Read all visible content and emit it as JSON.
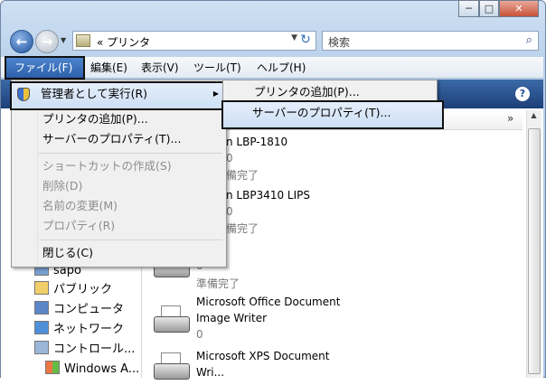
{
  "window": {
    "minimize": "─",
    "maximize": "□",
    "close": "✕"
  },
  "nav": {
    "back": "←",
    "forward": "→",
    "history": "▼",
    "address_text": "« プリンタ",
    "address_dropdown": "▼",
    "refresh": "↻",
    "search_placeholder": "検索",
    "search_icon": "⌕"
  },
  "menubar": [
    {
      "label": "ファイル(F)"
    },
    {
      "label": "編集(E)"
    },
    {
      "label": "表示(V)"
    },
    {
      "label": "ツール(T)"
    },
    {
      "label": "ヘルプ(H)"
    }
  ],
  "file_menu": {
    "runas": "管理者として実行(R)",
    "add_printer": "プリンタの追加(P)...",
    "server_props": "サーバーのプロパティ(T)...",
    "create_shortcut": "ショートカットの作成(S)",
    "delete": "削除(D)",
    "rename": "名前の変更(M)",
    "properties": "プロパティ(R)",
    "close": "閉じる(C)"
  },
  "submenu": {
    "add_printer": "プリンタの追加(P)...",
    "server_props": "サーバーのプロパティ(T)..."
  },
  "toolbar": {
    "help": "?"
  },
  "columns": {
    "more": "»"
  },
  "tree": [
    {
      "label": "sapo",
      "icon": "user-icon"
    },
    {
      "label": "パブリック",
      "icon": "folder-icon"
    },
    {
      "label": "コンピュータ",
      "icon": "computer-icon"
    },
    {
      "label": "ネットワーク",
      "icon": "network-icon"
    },
    {
      "label": "コントロール...",
      "icon": "control-panel-icon"
    },
    {
      "label": "Windows A...",
      "icon": "windows-icon"
    }
  ],
  "printers": [
    {
      "name_partial": "n LBP-1810",
      "count": "0",
      "status_partial": "備完了"
    },
    {
      "name_partial": "n LBP3410 LIPS",
      "count": "0",
      "status_partial": "備完了"
    },
    {
      "count": "0",
      "status": "準備完了"
    },
    {
      "name_line1": "Microsoft Office Document",
      "name_line2": "Image Writer",
      "count": "0"
    },
    {
      "name_line1": "Microsoft XPS Document",
      "name_line2": "Wri..."
    }
  ]
}
